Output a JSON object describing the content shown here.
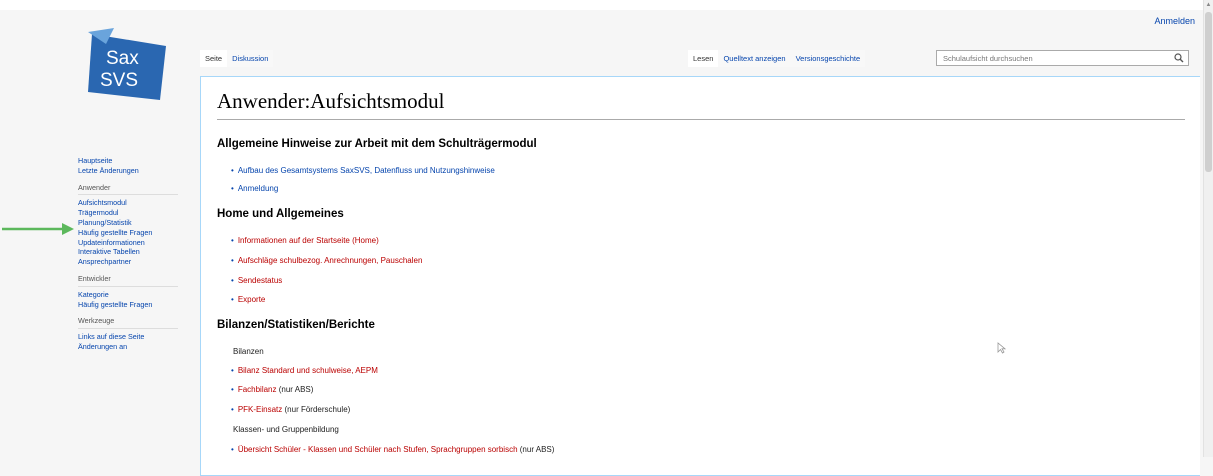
{
  "header": {
    "login_label": "Anmelden"
  },
  "logo": {
    "line1": "Sax",
    "line2": "SVS"
  },
  "sidebar": {
    "nav": [
      "Hauptseite",
      "Letzte Änderungen"
    ],
    "section1_heading": "Anwender",
    "section1": [
      "Aufsichtsmodul",
      "Trägermodul",
      "Planung/Statistik",
      "Häufig gestellte Fragen",
      "Updateinformationen",
      "Interaktive Tabellen",
      "Ansprechpartner"
    ],
    "section2_heading": "Entwickler",
    "section2": [
      "Kategorie",
      "Häufig gestellte Fragen"
    ],
    "section3_heading": "Werkzeuge",
    "section3": [
      "Links auf diese Seite",
      "Änderungen an"
    ]
  },
  "tabs": {
    "page": "Seite",
    "discussion": "Diskussion",
    "read": "Lesen",
    "source": "Quelltext anzeigen",
    "history": "Versionsgeschichte"
  },
  "search": {
    "placeholder": "Schulaufsicht durchsuchen"
  },
  "page": {
    "title": "Anwender:Aufsichtsmodul",
    "sections": [
      {
        "heading": "Allgemeine Hinweise zur Arbeit mit dem Schulträgermodul"
      },
      {
        "heading": "Home und Allgemeines"
      },
      {
        "heading": "Bilanzen/Statistiken/Berichte"
      }
    ],
    "items": {
      "s1_1": "Aufbau des Gesamtsystems SaxSVS, Datenfluss und Nutzungshinweise",
      "s1_2": "Anmeldung",
      "s2_1": "Informationen auf der Startseite (Home)",
      "s2_2": "Aufschläge schulbezog. Anrechnungen, Pauschalen",
      "s2_3": "Sendestatus",
      "s2_4": "Exporte",
      "s3_sub1": "Bilanzen",
      "s3_1": "Bilanz Standard und schulweise, AEPM",
      "s3_2_link": "Fachbilanz",
      "s3_2_text": " (nur ABS)",
      "s3_3_link": "PFK-Einsatz",
      "s3_3_text": " (nur Förderschule)",
      "s3_sub2": "Klassen- und Gruppenbildung",
      "s3_4_link": "Übersicht Schüler - Klassen und Schüler nach Stufen, Sprachgruppen sorbisch",
      "s3_4_text": " (nur ABS)"
    }
  },
  "colors": {
    "link": "#0645ad",
    "redlink": "#ba0000",
    "arrow": "#5cb85c",
    "logo": "#2a67b1"
  }
}
